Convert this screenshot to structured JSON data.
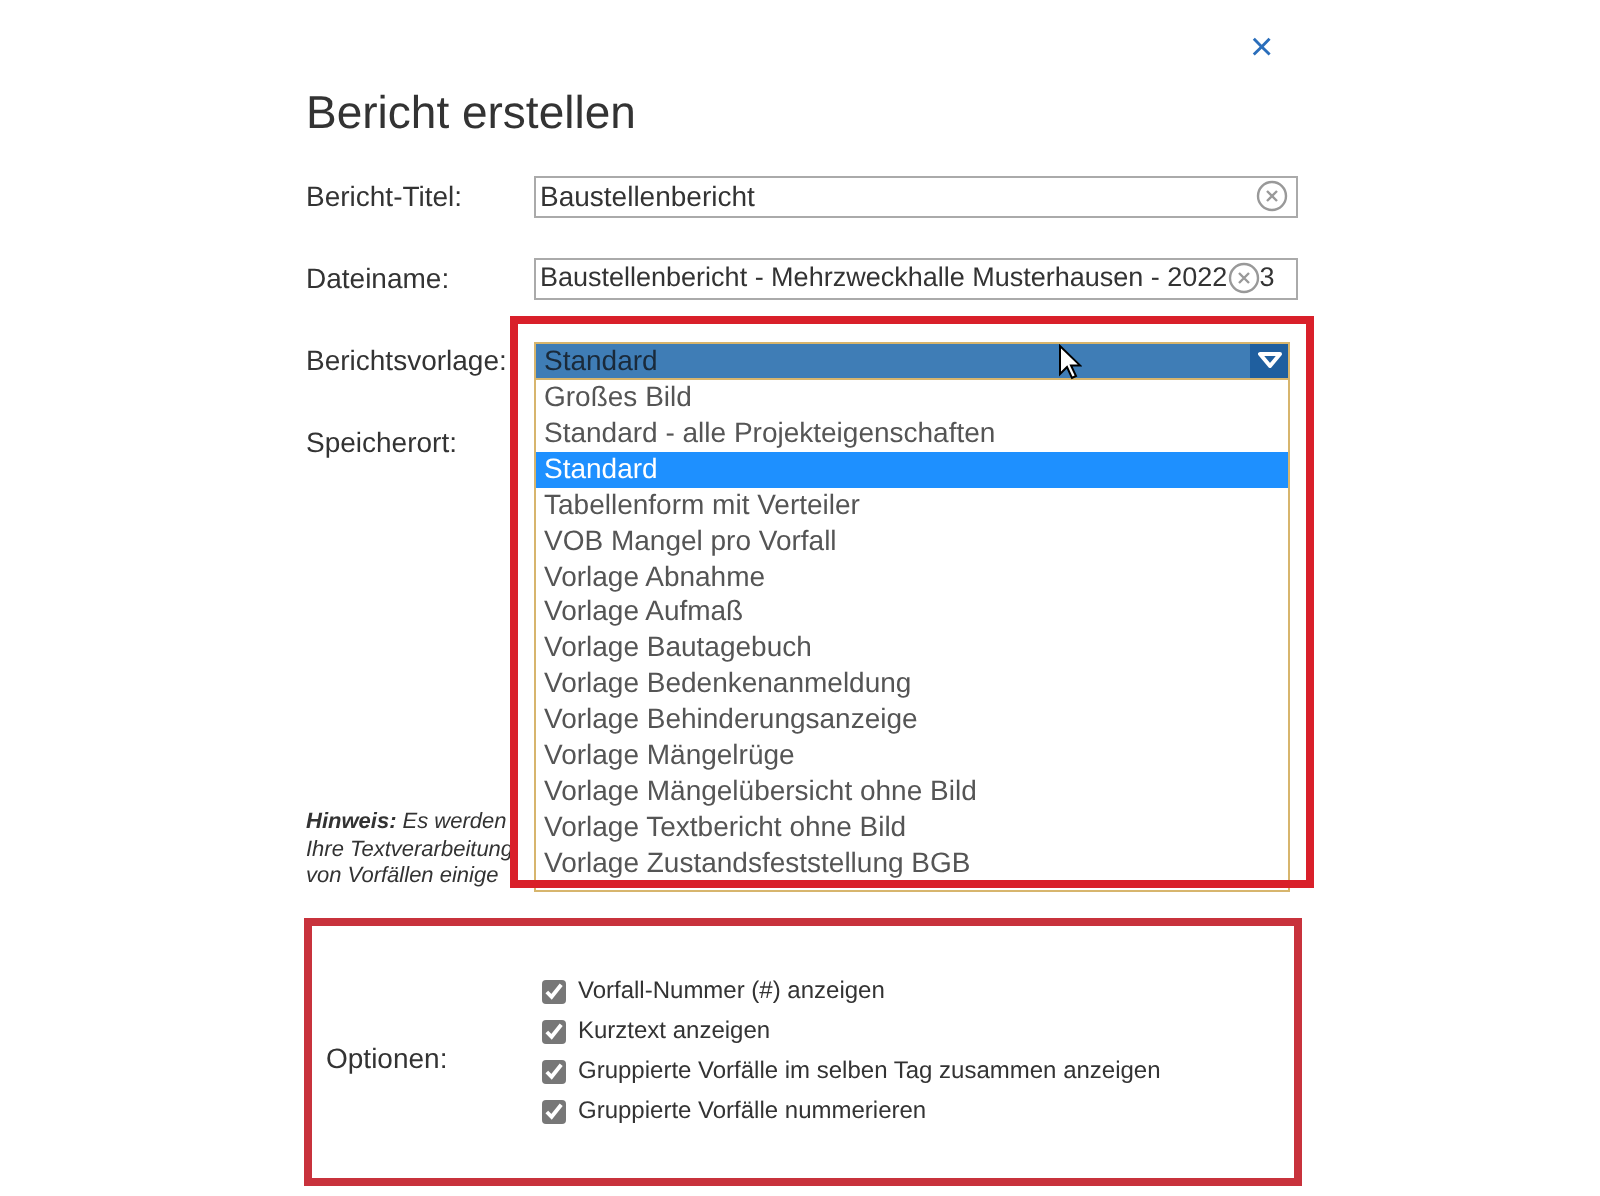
{
  "dialog": {
    "title": "Bericht erstellen",
    "close": "×"
  },
  "fields": [
    {
      "kind": "text",
      "label": "Bericht-Titel:",
      "value": "Baustellenbericht",
      "clearable": true
    },
    {
      "kind": "text",
      "label": "Dateiname:",
      "value": "Baustellenbericht - Mehrzweckhalle Musterhausen - 2022",
      "value_after_icon": "3",
      "clearable": true
    },
    {
      "kind": "select",
      "label": "Berichtsvorlage:",
      "value": "Standard",
      "expanded": true,
      "highlighted": true,
      "options": [
        {
          "label": "Großes Bild",
          "selected": false
        },
        {
          "label": "Standard - alle Projekteigenschaften",
          "selected": false
        },
        {
          "label": "Standard",
          "selected": true
        },
        {
          "label": "Tabellenform mit Verteiler",
          "selected": false
        },
        {
          "label": "VOB Mangel pro Vorfall",
          "selected": false
        },
        {
          "label": "Vorlage Abnahme",
          "selected": false
        },
        {
          "label": "Vorlage Aufmaß",
          "selected": false
        },
        {
          "label": "Vorlage Bautagebuch",
          "selected": false
        },
        {
          "label": "Vorlage Bedenkenanmeldung",
          "selected": false
        },
        {
          "label": "Vorlage Behinderungsanzeige",
          "selected": false
        },
        {
          "label": "Vorlage Mängelrüge",
          "selected": false
        },
        {
          "label": "Vorlage Mängelübersicht ohne Bild",
          "selected": false
        },
        {
          "label": "Vorlage Textbericht ohne Bild",
          "selected": false
        },
        {
          "label": "Vorlage Zustandsfeststellung BGB",
          "selected": false
        }
      ]
    },
    {
      "kind": "label",
      "label": "Speicherort:"
    }
  ],
  "hint_lines": [
    "**Hinweis:** Es werden",
    "Ihre Textverarbeitung",
    "von Vorfällen einige"
  ],
  "options_section": {
    "label": "Optionen:",
    "highlighted": true,
    "checkboxes": [
      {
        "label": "Vorfall-Nummer (#) anzeigen",
        "checked": true
      },
      {
        "label": "Kurztext anzeigen",
        "checked": true
      },
      {
        "label": "Gruppierte Vorfälle im selben Tag zusammen anzeigen",
        "checked": true
      },
      {
        "label": "Gruppierte Vorfälle nummerieren",
        "checked": true
      }
    ]
  }
}
